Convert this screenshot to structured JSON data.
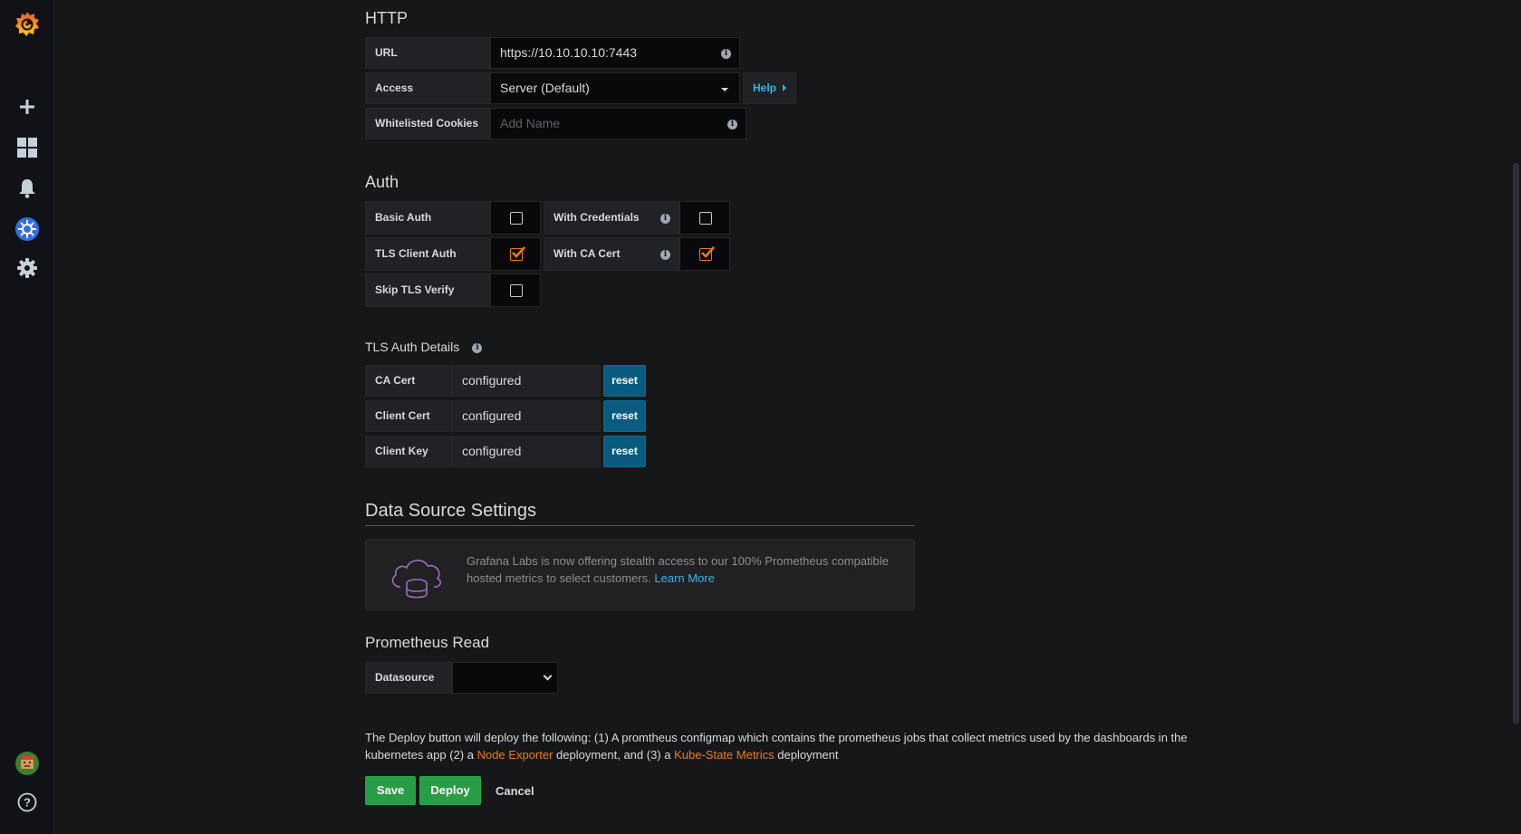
{
  "sidebar": {
    "icons": [
      "grafana-logo-icon",
      "plus-icon",
      "dashboards-icon",
      "bell-icon",
      "kubernetes-icon",
      "gear-icon",
      "avatar",
      "help-icon"
    ]
  },
  "http": {
    "title": "HTTP",
    "url_label": "URL",
    "url_value": "https://10.10.10.10:7443",
    "access_label": "Access",
    "access_value": "Server (Default)",
    "help_label": "Help",
    "cookies_label": "Whitelisted Cookies",
    "cookies_placeholder": "Add Name"
  },
  "auth": {
    "title": "Auth",
    "basic_auth": {
      "label": "Basic Auth",
      "checked": false
    },
    "with_credentials": {
      "label": "With Credentials",
      "checked": false
    },
    "tls_client_auth": {
      "label": "TLS Client Auth",
      "checked": true
    },
    "with_ca_cert": {
      "label": "With CA Cert",
      "checked": true
    },
    "skip_tls_verify": {
      "label": "Skip TLS Verify",
      "checked": false
    }
  },
  "tls": {
    "title": "TLS Auth Details",
    "rows": [
      {
        "label": "CA Cert",
        "value": "configured",
        "button": "reset"
      },
      {
        "label": "Client Cert",
        "value": "configured",
        "button": "reset"
      },
      {
        "label": "Client Key",
        "value": "configured",
        "button": "reset"
      }
    ]
  },
  "datasource_settings": {
    "title": "Data Source Settings",
    "promo_text": "Grafana Labs is now offering stealth access to our 100% Prometheus compatible hosted metrics to select customers.",
    "promo_link": "Learn More"
  },
  "prometheus_read": {
    "title": "Prometheus Read",
    "datasource_label": "Datasource",
    "datasource_value": ""
  },
  "deploy_note": {
    "part1": "The Deploy button will deploy the following: (1) A promtheus configmap which contains the prometheus jobs that collect metrics used by the dashboards in the kubernetes app (2) a ",
    "link1": "Node Exporter",
    "part2": " deployment, and (3) a ",
    "link2": "Kube-State Metrics",
    "part3": " deployment"
  },
  "actions": {
    "save": "Save",
    "deploy": "Deploy",
    "cancel": "Cancel"
  },
  "colors": {
    "accent_orange": "#eb7b18",
    "link_blue": "#33b5e5",
    "button_green": "#299c46",
    "reset_blue": "#0b5b80"
  }
}
